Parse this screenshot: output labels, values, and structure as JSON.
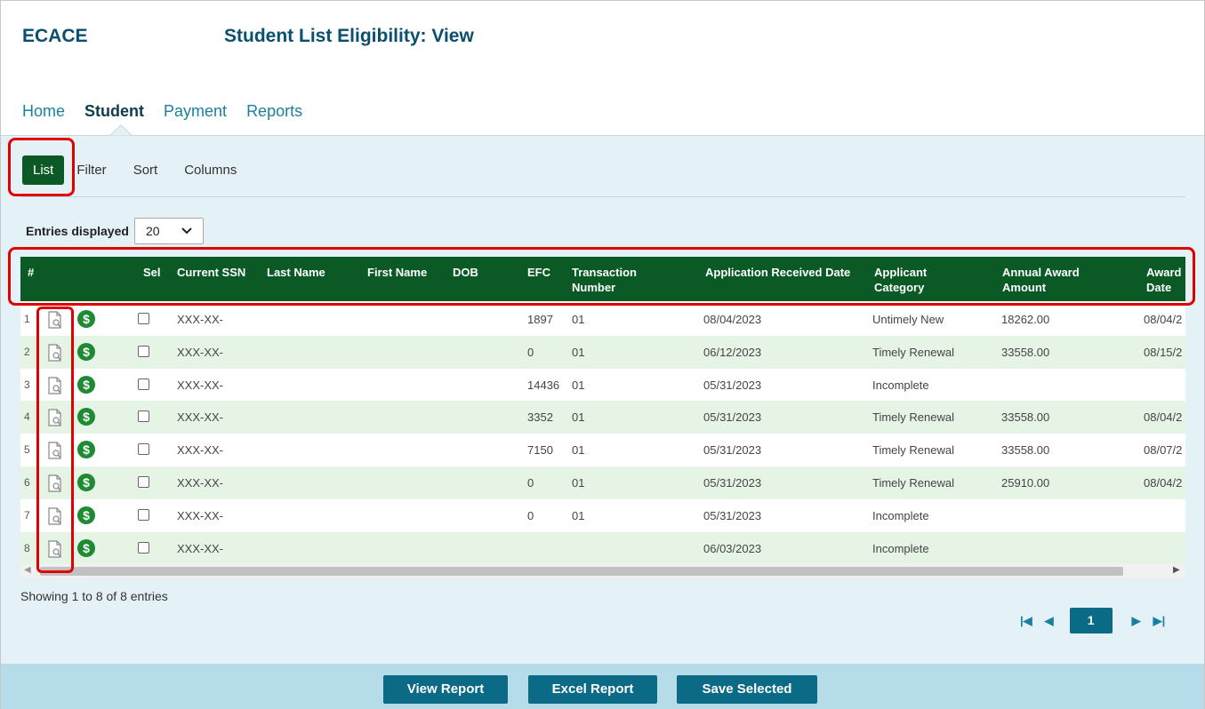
{
  "app": {
    "brand": "ECACE",
    "title": "Student List Eligibility: View"
  },
  "nav": {
    "items": [
      "Home",
      "Student",
      "Payment",
      "Reports"
    ],
    "active": "Student"
  },
  "subtabs": {
    "items": [
      "List",
      "Filter",
      "Sort",
      "Columns"
    ],
    "active": "List"
  },
  "entries": {
    "label": "Entries displayed",
    "value": "20"
  },
  "table": {
    "headers": {
      "num": "#",
      "sel": "Sel",
      "ssn": "Current SSN",
      "last": "Last Name",
      "first": "First Name",
      "dob": "DOB",
      "efc": "EFC",
      "txn": "Transaction Number",
      "app_date": "Application Received Date",
      "category": "Applicant Category",
      "award": "Annual Award Amount",
      "award_date": "Award Date"
    },
    "rows": [
      {
        "num": "1",
        "ssn": "XXX-XX-",
        "efc": "1897",
        "txn": "01",
        "app_date": "08/04/2023",
        "category": "Untimely New",
        "award": "18262.00",
        "award_date": "08/04/2"
      },
      {
        "num": "2",
        "ssn": "XXX-XX-",
        "efc": "0",
        "txn": "01",
        "app_date": "06/12/2023",
        "category": "Timely Renewal",
        "award": "33558.00",
        "award_date": "08/15/2"
      },
      {
        "num": "3",
        "ssn": "XXX-XX-",
        "efc": "14436",
        "txn": "01",
        "app_date": "05/31/2023",
        "category": "Incomplete",
        "award": "",
        "award_date": ""
      },
      {
        "num": "4",
        "ssn": "XXX-XX-",
        "efc": "3352",
        "txn": "01",
        "app_date": "05/31/2023",
        "category": "Timely Renewal",
        "award": "33558.00",
        "award_date": "08/04/2"
      },
      {
        "num": "5",
        "ssn": "XXX-XX-",
        "efc": "7150",
        "txn": "01",
        "app_date": "05/31/2023",
        "category": "Timely Renewal",
        "award": "33558.00",
        "award_date": "08/07/2"
      },
      {
        "num": "6",
        "ssn": "XXX-XX-",
        "efc": "0",
        "txn": "01",
        "app_date": "05/31/2023",
        "category": "Timely Renewal",
        "award": "25910.00",
        "award_date": "08/04/2"
      },
      {
        "num": "7",
        "ssn": "XXX-XX-",
        "efc": "0",
        "txn": "01",
        "app_date": "05/31/2023",
        "category": "Incomplete",
        "award": "",
        "award_date": ""
      },
      {
        "num": "8",
        "ssn": "XXX-XX-",
        "efc": "",
        "txn": "",
        "app_date": "06/03/2023",
        "category": "Incomplete",
        "award": "",
        "award_date": ""
      }
    ],
    "row_icons": [
      "document-search-icon",
      "dollar-icon"
    ],
    "dollar_glyph": "$"
  },
  "showing": "Showing 1 to 8 of 8 entries",
  "pager": {
    "current": "1",
    "icons": [
      "first-page-icon",
      "prev-page-icon",
      "next-page-icon",
      "last-page-icon"
    ]
  },
  "footer": {
    "buttons": [
      "View Report",
      "Excel Report",
      "Save Selected"
    ]
  },
  "colors": {
    "brand_text": "#0a4f6e",
    "header_green": "#0b5a26",
    "accent_blue": "#0b6a85",
    "row_alt": "#e6f4e6",
    "highlight": "#e00000"
  }
}
